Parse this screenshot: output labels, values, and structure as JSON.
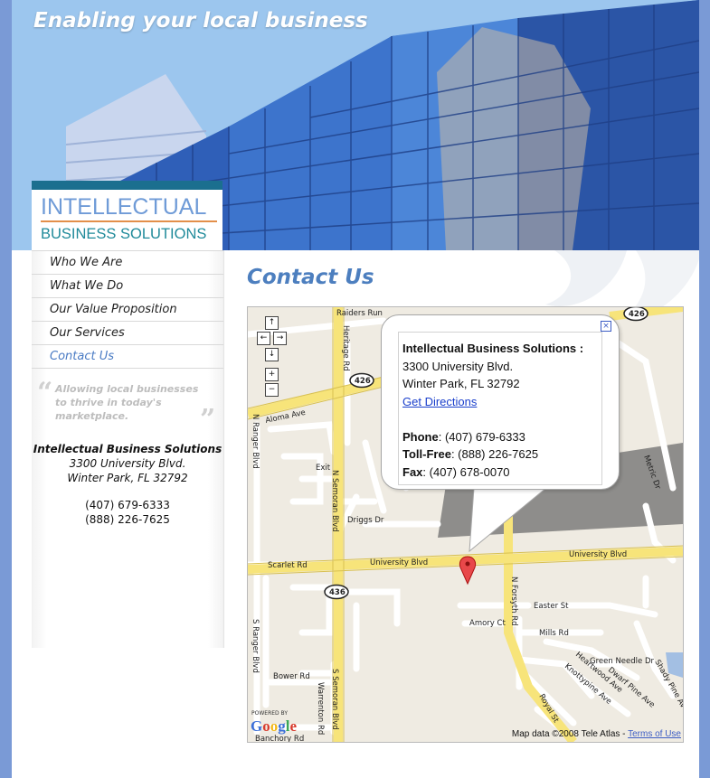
{
  "header": {
    "tagline": "Enabling your local business"
  },
  "logo": {
    "line1": "INTELLECTUAL",
    "line2": "BUSINESS SOLUTIONS"
  },
  "nav": {
    "items": [
      {
        "label": "Who We Are"
      },
      {
        "label": "What We Do"
      },
      {
        "label": "Our Value Proposition"
      },
      {
        "label": "Our Services"
      },
      {
        "label": "Contact Us",
        "active": true
      }
    ]
  },
  "sidebar": {
    "quote": "Allowing local businesses to thrive in today's marketplace.",
    "company": "Intellectual Business Solutions",
    "street": "3300 University Blvd.",
    "city": "Winter Park, FL 32792",
    "phone1": "(407) 679-6333",
    "phone2": "(888) 226-7625"
  },
  "main": {
    "title": "Contact Us"
  },
  "map": {
    "popup": {
      "company": "Intellectual Business Solutions :",
      "street": "3300 University Blvd.",
      "city": "Winter Park, FL 32792",
      "directions_link": "Get Directions",
      "phone_label": "Phone",
      "phone": ": (407) 679-6333",
      "tollfree_label": "Toll-Free",
      "tollfree": ": (888) 226-7625",
      "fax_label": "Fax",
      "fax": ": (407) 678-0070"
    },
    "labels": {
      "raiders_run": "Raiders Run",
      "heritage_rd": "Heritage Rd",
      "aloma_ave": "Aloma Ave",
      "n_ranger_blvd": "N Ranger Blvd",
      "n_semoran_blvd": "N Semoran Blvd",
      "s_semoran_blvd": "S Semoran Blvd",
      "s_ranger_blvd": "S Ranger Blvd",
      "driggs_dr": "Driggs Dr",
      "exit": "Exit",
      "scarlet_rd": "Scarlet Rd",
      "university_blvd_1": "University Blvd",
      "university_blvd_2": "University Blvd",
      "n_forsyth_rd": "N Forsyth Rd",
      "easter_st": "Easter St",
      "amory_ct": "Amory Ct",
      "mills_rd": "Mills Rd",
      "bower_rd": "Bower Rd",
      "warrenton_rd": "Warrenton Rd",
      "banchory_rd": "Banchory Rd",
      "royal_st": "Royal St",
      "green_needle_dr": "Green Needle Dr",
      "dwarf_pine_ave": "Dwarf Pine Ave",
      "shady_pine_ave": "Shady Pine Ave",
      "knottypine_ave": "Knottypine Ave",
      "heartwood_ave": "Heartwood Ave",
      "metric_dr": "Metric Dr",
      "shield_426a": "426",
      "shield_426b": "426",
      "shield_436": "436"
    },
    "controls": {
      "up": "↑",
      "left": "←",
      "right": "→",
      "down": "↓",
      "zoom_in": "+",
      "zoom_out": "−"
    },
    "attribution": "Map data ©2008 Tele Atlas - ",
    "terms": "Terms of Use",
    "powered_by": "POWERED BY",
    "google": "Google"
  }
}
